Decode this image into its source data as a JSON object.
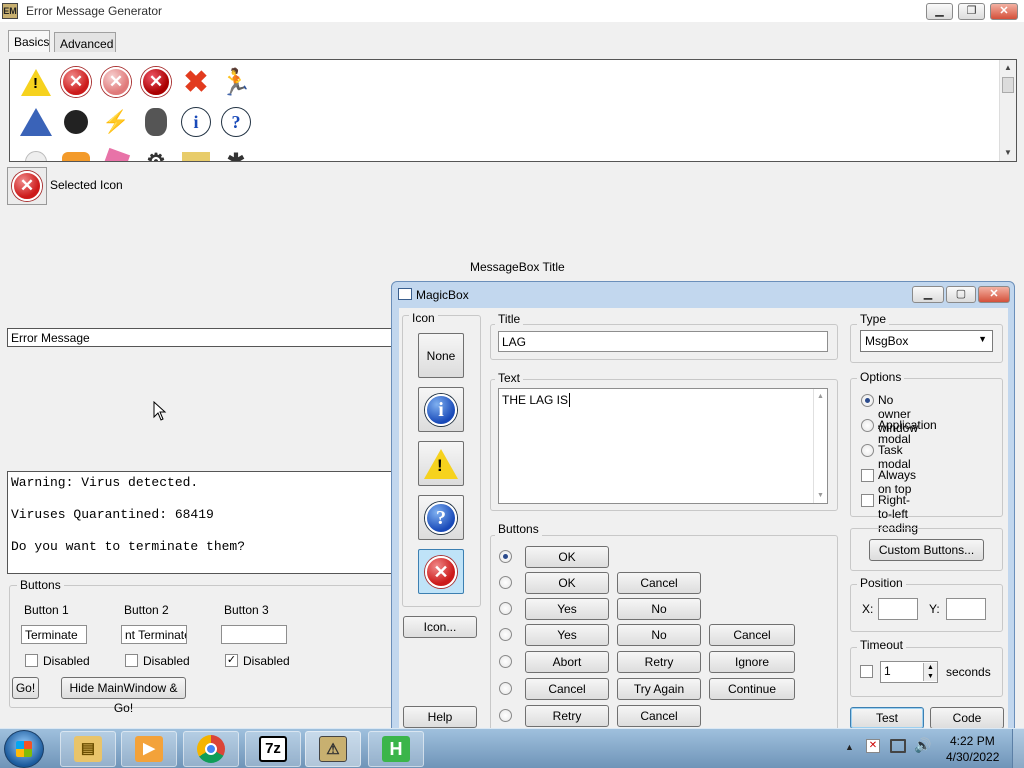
{
  "main_window": {
    "title": "Error Message Generator",
    "tabs": [
      "Basics",
      "Advanced"
    ],
    "selected_icon_label": "Selected Icon",
    "messagebox_title_label": "MessageBox Title",
    "error_message_field": "Error Message",
    "message_text": "Warning: Virus detected.\n\nViruses Quarantined: 68419\n\nDo you want to terminate them?",
    "buttons_group": {
      "legend": "Buttons",
      "button1_label": "Button 1",
      "button2_label": "Button 2",
      "button3_label": "Button 3",
      "button1_value": "Terminate",
      "button2_value": "nt Terminate",
      "button3_value": "",
      "disabled_label": "Disabled",
      "button1_disabled": false,
      "button2_disabled": false,
      "button3_disabled": true,
      "go_label": "Go!",
      "hide_go_label": "Hide MainWindow & Go!"
    },
    "caption_buttons": [
      "minimize",
      "maximize",
      "close"
    ]
  },
  "magicbox": {
    "title": "MagicBox",
    "icon_group_label": "Icon",
    "icon_options": [
      "None",
      "info-icon",
      "warning-icon",
      "question-icon",
      "error-icon"
    ],
    "selected_icon": "error-icon",
    "icon_button_label": "Icon...",
    "help_label": "Help",
    "title_group_label": "Title",
    "title_value": "LAG",
    "text_group_label": "Text",
    "text_value": "THE LAG IS",
    "buttons_group_label": "Buttons",
    "button_rows": [
      {
        "buttons": [
          "OK"
        ],
        "selected": true
      },
      {
        "buttons": [
          "OK",
          "Cancel"
        ],
        "selected": false
      },
      {
        "buttons": [
          "Yes",
          "No"
        ],
        "selected": false
      },
      {
        "buttons": [
          "Yes",
          "No",
          "Cancel"
        ],
        "selected": false
      },
      {
        "buttons": [
          "Abort",
          "Retry",
          "Ignore"
        ],
        "selected": false
      },
      {
        "buttons": [
          "Cancel",
          "Try Again",
          "Continue"
        ],
        "selected": false
      },
      {
        "buttons": [
          "Retry",
          "Cancel"
        ],
        "selected": false
      }
    ],
    "type_group_label": "Type",
    "type_value": "MsgBox",
    "options_group_label": "Options",
    "radio_options": [
      {
        "label": "No owner window",
        "checked": true
      },
      {
        "label": "Application modal",
        "checked": false
      },
      {
        "label": "Task modal",
        "checked": false
      }
    ],
    "check_options": [
      {
        "label": "Always on top",
        "checked": false
      },
      {
        "label": "Right-to-left reading",
        "checked": false
      }
    ],
    "custom_buttons_label": "Custom Buttons...",
    "position_group_label": "Position",
    "x_label": "X:",
    "y_label": "Y:",
    "x_value": "",
    "y_value": "",
    "timeout_group_label": "Timeout",
    "timeout_enabled": false,
    "timeout_value": "1",
    "seconds_label": "seconds",
    "test_label": "Test",
    "code_label": "Code"
  },
  "taskbar": {
    "items": [
      "windows-explorer",
      "media-player",
      "chrome",
      "7-zip",
      "error-message-generator",
      "hotspot-shield"
    ],
    "tray_icons": [
      "show-hidden-icons",
      "action-center",
      "network",
      "volume"
    ],
    "time": "4:22 PM",
    "date": "4/30/2022"
  }
}
